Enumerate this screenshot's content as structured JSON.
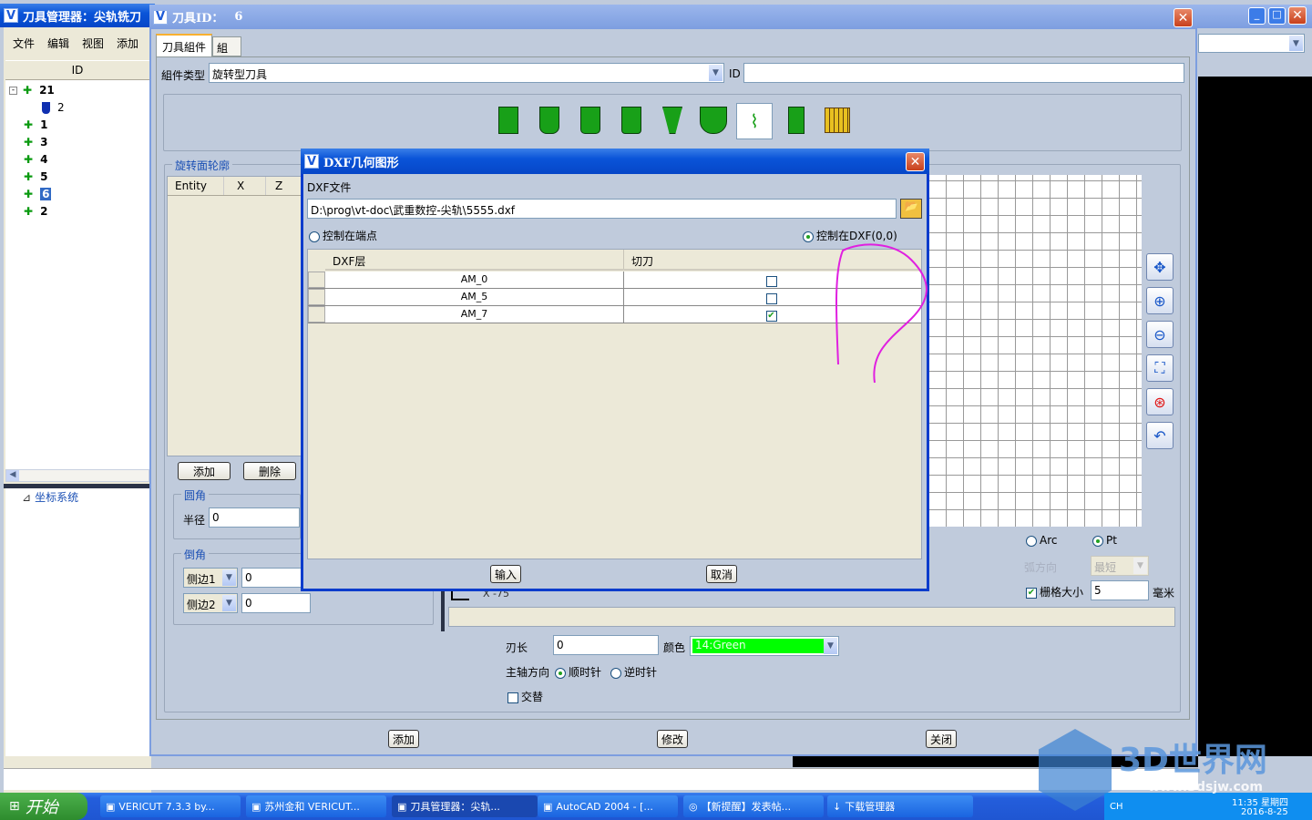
{
  "main_window": {
    "title": "刀具管理器：尖轨铣刀",
    "menu": [
      "文件",
      "编辑",
      "视图",
      "添加"
    ],
    "id_header": "ID",
    "tree": [
      {
        "label": "21",
        "icon": "tool-assembly-icon"
      },
      {
        "label": "2",
        "icon": "holder-icon",
        "child": true
      },
      {
        "label": "1",
        "icon": "tool-assembly-icon"
      },
      {
        "label": "3",
        "icon": "tool-assembly-icon"
      },
      {
        "label": "4",
        "icon": "tool-assembly-icon"
      },
      {
        "label": "5",
        "icon": "tool-assembly-icon"
      },
      {
        "label": "6",
        "icon": "tool-assembly-icon",
        "selected": true
      },
      {
        "label": "2",
        "icon": "tool-assembly-icon"
      }
    ],
    "coord_tree": "坐标系统"
  },
  "tool_dialog": {
    "title": "刀具ID：",
    "title_id": "6",
    "tabs": [
      "刀具組件",
      "組合"
    ],
    "component_type_label": "組件类型",
    "component_type_value": "旋转型刀具",
    "id_label": "ID",
    "id_value": "",
    "profile_group": "旋转面轮廓",
    "profile_columns": [
      "Entity",
      "X",
      "Z"
    ],
    "add": "添加",
    "delete": "删除",
    "fillet_group": "圆角",
    "radius_label": "半径",
    "radius_value": "0",
    "chamfer_group": "倒角",
    "side1": "侧边1",
    "side1_value": "0",
    "side2": "侧边2",
    "side2_value": "0",
    "x_readout": "X -75",
    "arc": "Arc",
    "pt": "Pt",
    "pt_selected": true,
    "arc_dir_label": "弧方向",
    "arc_dir_value": "最短",
    "grid_label": "栅格大小",
    "grid_checked": true,
    "grid_value": "5",
    "grid_unit": "毫米",
    "blade_len_label": "刃长",
    "blade_len_value": "0",
    "color_label": "颜色",
    "color_value": "14:Green",
    "color_hex": "#00ff00",
    "spindle_label": "主轴方向",
    "cw": "顺时针",
    "ccw": "逆时针",
    "cw_selected": true,
    "alternate": "交替",
    "alternate_checked": false,
    "buttons": {
      "add": "添加",
      "modify": "修改",
      "close": "关闭"
    }
  },
  "dxf_dialog": {
    "title": "DXF几何图形",
    "file_label": "DXF文件",
    "file_value": "D:\\prog\\vt-doc\\武重数控-尖轨\\5555.dxf",
    "radio_endpoint": "控制在端点",
    "radio_origin": "控制在DXF(0,0)",
    "origin_selected": true,
    "columns": [
      "DXF层",
      "切刀"
    ],
    "rows": [
      {
        "layer": "AM_0",
        "cutter": false
      },
      {
        "layer": "AM_5",
        "cutter": false
      },
      {
        "layer": "AM_7",
        "cutter": true
      }
    ],
    "ok": "输入",
    "cancel": "取消"
  },
  "taskbar": {
    "start": "开始",
    "items": [
      "VERICUT 7.3.3 by...",
      "苏州金和 VERICUT...",
      "刀具管理器：尖轨...",
      "AutoCAD 2004 - [...",
      "【新提醒】发表帖...",
      "下载管理器"
    ],
    "active_index": 2,
    "lang": "CH",
    "time": "11:35 星期四",
    "date": "2016-8-25"
  },
  "watermark": {
    "text": "3D世界网",
    "url": "www.3dsjw.com"
  },
  "annotation_color": "#e020e0"
}
